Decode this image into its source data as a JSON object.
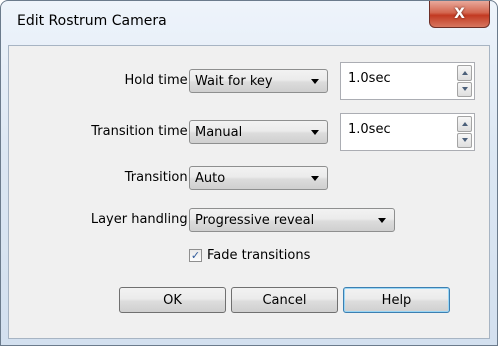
{
  "window": {
    "title": "Edit Rostrum Camera",
    "close_glyph": "X"
  },
  "fields": {
    "hold_time": {
      "label": "Hold time:",
      "value": "Wait for key",
      "duration": "1.0sec"
    },
    "transition_time": {
      "label": "Transition time:",
      "value": "Manual",
      "duration": "1.0sec"
    },
    "transition": {
      "label": "Transition:",
      "value": "Auto"
    },
    "layer_handling": {
      "label": "Layer handling:",
      "value": "Progressive reveal"
    }
  },
  "fade_transitions": {
    "label": "Fade transitions",
    "checked": true,
    "check_glyph": "✓"
  },
  "buttons": {
    "ok": "OK",
    "cancel": "Cancel",
    "help": "Help"
  },
  "colors": {
    "close_button": "#c94a33",
    "default_button_border": "#3c7fb1"
  }
}
